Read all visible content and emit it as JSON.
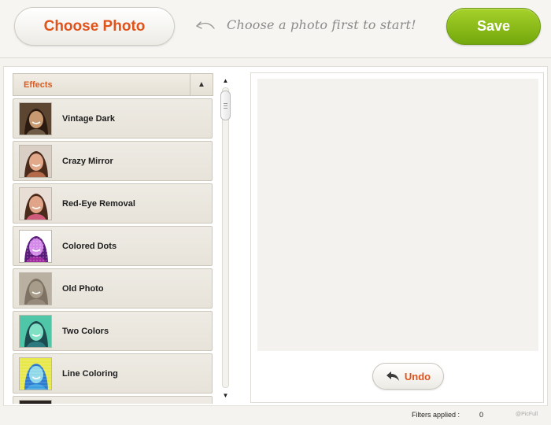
{
  "header": {
    "choose_label": "Choose Photo",
    "hint": "Choose a photo first to start!",
    "save_label": "Save"
  },
  "effects": {
    "title": "Effects",
    "items": [
      {
        "label": "Vintage Dark",
        "style": "vintage-dark"
      },
      {
        "label": "Crazy Mirror",
        "style": "crazy-mirror"
      },
      {
        "label": "Red-Eye Removal",
        "style": "red-eye"
      },
      {
        "label": "Colored Dots",
        "style": "colored-dots"
      },
      {
        "label": "Old Photo",
        "style": "old-photo"
      },
      {
        "label": "Two Colors",
        "style": "two-colors"
      },
      {
        "label": "Line Coloring",
        "style": "line-coloring"
      }
    ]
  },
  "preview": {
    "undo_label": "Undo"
  },
  "footer": {
    "filters_label": "Filters applied :",
    "filters_count": "0",
    "brand": "@PicFull"
  },
  "colors": {
    "accent_orange": "#e0541c",
    "save_green": "#8bbd1b"
  },
  "icons": {
    "hint": "curved-arrow-left-icon",
    "collapse": "triangle-up-icon",
    "scroll_up": "triangle-up-icon",
    "scroll_down": "triangle-down-icon",
    "undo": "undo-arrow-icon"
  }
}
